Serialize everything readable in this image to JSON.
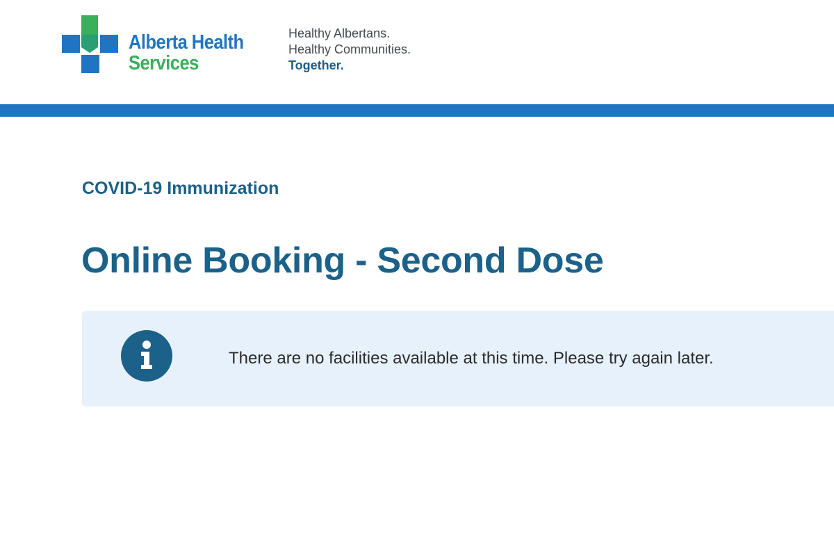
{
  "header": {
    "brand_line1": "Alberta Health",
    "brand_line2": "Services",
    "tagline": [
      "Healthy Albertans.",
      "Healthy Communities.",
      "Together."
    ],
    "logo_icon": "ahs-cross-logo-icon"
  },
  "main": {
    "section_label": "COVID-19 Immunization",
    "page_title": "Online Booking - Second Dose",
    "alert": {
      "icon": "info-icon",
      "message": "There are no facilities available at this time. Please try again later."
    }
  },
  "colors": {
    "brand_blue": "#1f75c4",
    "brand_green": "#3aaf5c",
    "heading_blue": "#1b6189",
    "alert_bg": "#e6f1fb"
  }
}
